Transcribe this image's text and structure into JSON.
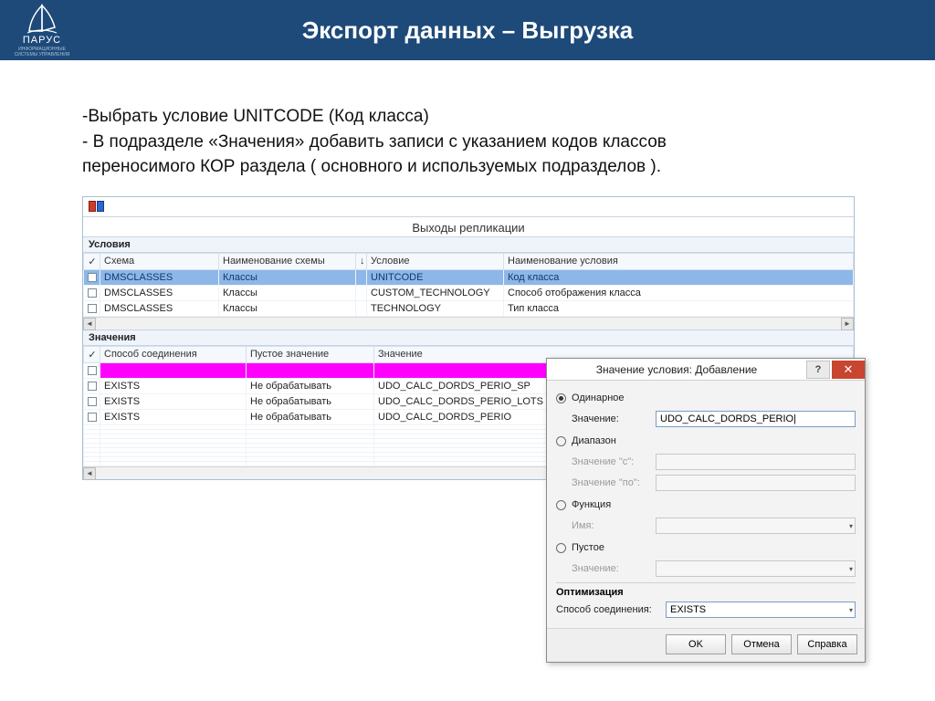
{
  "header": {
    "brand": "ПАРУС",
    "subtitle": "ИНФОРМАЦИОННЫЕ СИСТЕМЫ УПРАВЛЕНИЯ",
    "title": "Экспорт данных – Выгрузка"
  },
  "bullets": {
    "l1": "-Выбрать условие UNITCODE (Код класса)",
    "l2": "- В подразделе «Значения» добавить записи с указанием кодов классов",
    "l3": "переносимого КОР раздела ( основного и используемых подразделов )."
  },
  "app": {
    "title": "Выходы репликации",
    "sections": {
      "cond": "Условия",
      "vals": "Значения"
    },
    "cond_cols": {
      "c1": "Схема",
      "c2": "Наименование схемы",
      "c3": "Условие",
      "c4": "Наименование условия"
    },
    "cond_rows": [
      {
        "c1": "DMSCLASSES",
        "c2": "Классы",
        "c3": "UNITCODE",
        "c4": "Код класса",
        "sel": true
      },
      {
        "c1": "DMSCLASSES",
        "c2": "Классы",
        "c3": "CUSTOM_TECHNOLOGY",
        "c4": "Способ отображения класса",
        "sel": false
      },
      {
        "c1": "DMSCLASSES",
        "c2": "Классы",
        "c3": "TECHNOLOGY",
        "c4": "Тип класса",
        "sel": false
      }
    ],
    "vals_cols": {
      "c1": "Способ соединения",
      "c2": "Пустое значение",
      "c3": "Значение"
    },
    "vals_rows": [
      {
        "c1": "",
        "c2": "",
        "c3": "",
        "magenta": true
      },
      {
        "c1": "EXISTS",
        "c2": "Не обрабатывать",
        "c3": "UDO_CALC_DORDS_PERIO_SP"
      },
      {
        "c1": "EXISTS",
        "c2": "Не обрабатывать",
        "c3": "UDO_CALC_DORDS_PERIO_LOTS"
      },
      {
        "c1": "EXISTS",
        "c2": "Не обрабатывать",
        "c3": "UDO_CALC_DORDS_PERIO"
      }
    ],
    "sort_arrow": "↓"
  },
  "dialog": {
    "title": "Значение условия: Добавление",
    "help": "?",
    "close": "✕",
    "r_single": "Одинарное",
    "lbl_value": "Значение:",
    "value_input": "UDO_CALC_DORDS_PERIO|",
    "r_range": "Диапазон",
    "lbl_from": "Значение \"с\":",
    "lbl_to": "Значение \"по\":",
    "r_func": "Функция",
    "lbl_name": "Имя:",
    "r_empty": "Пустое",
    "lbl_empty_val": "Значение:",
    "opt_title": "Оптимизация",
    "lbl_join": "Способ соединения:",
    "join_value": "EXISTS",
    "btn_ok": "OK",
    "btn_cancel": "Отмена",
    "btn_help": "Справка"
  }
}
